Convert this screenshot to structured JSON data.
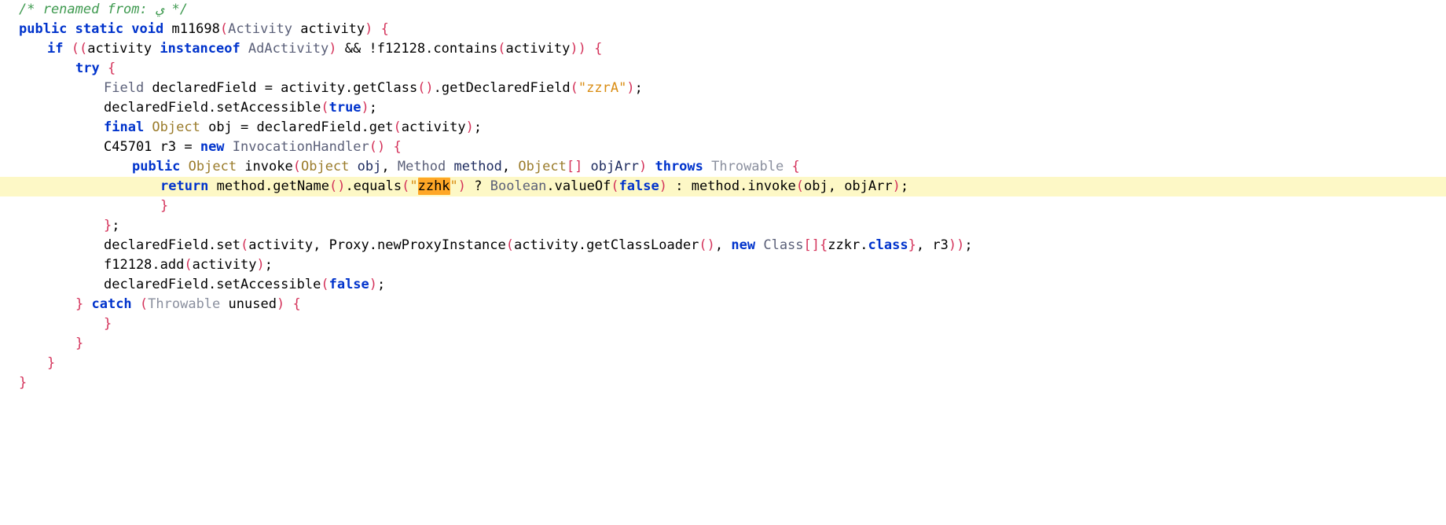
{
  "editor": {
    "title": "decompiled-java-source",
    "language": "java",
    "background_color": "#ffffff",
    "highlight_line_color": "#fdf8c6",
    "search_match_color": "#ffa726",
    "search_match_text": "zzhk",
    "colors": {
      "comment": "#3f9a50",
      "keyword": "#0033cc",
      "type": "#9a7b2a",
      "type_alt": "#5a5f78",
      "punctuation": "#d4325a",
      "string": "#d98c12",
      "variable": "#1c2a5e",
      "plain": "#000000",
      "throws_clause": "#8a8f9e"
    }
  },
  "code": {
    "lines": [
      {
        "id": "line-1",
        "indent": 0,
        "highlighted": false,
        "tokens": [
          {
            "cls": "t-comment",
            "text": "/* renamed from: ي */"
          }
        ]
      },
      {
        "id": "line-2",
        "indent": 0,
        "highlighted": false,
        "tokens": [
          {
            "cls": "t-keyword",
            "text": "public static void "
          },
          {
            "cls": "t-ident",
            "text": "m11698"
          },
          {
            "cls": "t-punct",
            "text": "("
          },
          {
            "cls": "t-type2",
            "text": "Activity"
          },
          {
            "cls": "t-plain",
            "text": " activity"
          },
          {
            "cls": "t-punct",
            "text": ")"
          },
          {
            "cls": "t-plain",
            "text": " "
          },
          {
            "cls": "t-punct",
            "text": "{"
          }
        ]
      },
      {
        "id": "line-3",
        "indent": 1,
        "highlighted": false,
        "tokens": [
          {
            "cls": "t-keyword",
            "text": "if "
          },
          {
            "cls": "t-punct",
            "text": "(("
          },
          {
            "cls": "t-plain",
            "text": "activity "
          },
          {
            "cls": "t-keyword",
            "text": "instanceof "
          },
          {
            "cls": "t-type2",
            "text": "AdActivity"
          },
          {
            "cls": "t-punct",
            "text": ")"
          },
          {
            "cls": "t-plain",
            "text": " && !f12128.contains"
          },
          {
            "cls": "t-punct",
            "text": "("
          },
          {
            "cls": "t-plain",
            "text": "activity"
          },
          {
            "cls": "t-punct",
            "text": "))"
          },
          {
            "cls": "t-plain",
            "text": " "
          },
          {
            "cls": "t-punct",
            "text": "{"
          }
        ]
      },
      {
        "id": "line-4",
        "indent": 2,
        "highlighted": false,
        "tokens": [
          {
            "cls": "t-keyword",
            "text": "try "
          },
          {
            "cls": "t-punct",
            "text": "{"
          }
        ]
      },
      {
        "id": "line-5",
        "indent": 3,
        "highlighted": false,
        "tokens": [
          {
            "cls": "t-type2",
            "text": "Field"
          },
          {
            "cls": "t-plain",
            "text": " declaredField = activity.getClass"
          },
          {
            "cls": "t-punct",
            "text": "()"
          },
          {
            "cls": "t-plain",
            "text": ".getDeclaredField"
          },
          {
            "cls": "t-punct",
            "text": "("
          },
          {
            "cls": "t-string",
            "text": "\"zzrA\""
          },
          {
            "cls": "t-punct",
            "text": ")"
          },
          {
            "cls": "t-plain",
            "text": ";"
          }
        ]
      },
      {
        "id": "line-6",
        "indent": 3,
        "highlighted": false,
        "tokens": [
          {
            "cls": "t-plain",
            "text": "declaredField.setAccessible"
          },
          {
            "cls": "t-punct",
            "text": "("
          },
          {
            "cls": "t-keyword",
            "text": "true"
          },
          {
            "cls": "t-punct",
            "text": ")"
          },
          {
            "cls": "t-plain",
            "text": ";"
          }
        ]
      },
      {
        "id": "line-7",
        "indent": 3,
        "highlighted": false,
        "tokens": [
          {
            "cls": "t-keyword",
            "text": "final "
          },
          {
            "cls": "t-type",
            "text": "Object"
          },
          {
            "cls": "t-plain",
            "text": " obj = declaredField.get"
          },
          {
            "cls": "t-punct",
            "text": "("
          },
          {
            "cls": "t-plain",
            "text": "activity"
          },
          {
            "cls": "t-punct",
            "text": ")"
          },
          {
            "cls": "t-plain",
            "text": ";"
          }
        ]
      },
      {
        "id": "line-8",
        "indent": 3,
        "highlighted": false,
        "tokens": [
          {
            "cls": "t-plain",
            "text": "C45701 r3 = "
          },
          {
            "cls": "t-keyword",
            "text": "new "
          },
          {
            "cls": "t-type2",
            "text": "InvocationHandler"
          },
          {
            "cls": "t-punct",
            "text": "()"
          },
          {
            "cls": "t-plain",
            "text": " "
          },
          {
            "cls": "t-punct",
            "text": "{"
          }
        ]
      },
      {
        "id": "line-9",
        "indent": 4,
        "highlighted": false,
        "tokens": [
          {
            "cls": "t-keyword",
            "text": "public "
          },
          {
            "cls": "t-type",
            "text": "Object"
          },
          {
            "cls": "t-plain",
            "text": " invoke"
          },
          {
            "cls": "t-punct",
            "text": "("
          },
          {
            "cls": "t-type",
            "text": "Object"
          },
          {
            "cls": "t-var",
            "text": " obj"
          },
          {
            "cls": "t-plain",
            "text": ", "
          },
          {
            "cls": "t-type2",
            "text": "Method"
          },
          {
            "cls": "t-var",
            "text": " method"
          },
          {
            "cls": "t-plain",
            "text": ", "
          },
          {
            "cls": "t-type",
            "text": "Object"
          },
          {
            "cls": "t-punct",
            "text": "[]"
          },
          {
            "cls": "t-var",
            "text": " objArr"
          },
          {
            "cls": "t-punct",
            "text": ")"
          },
          {
            "cls": "t-plain",
            "text": " "
          },
          {
            "cls": "t-keyword",
            "text": "throws "
          },
          {
            "cls": "t-throws",
            "text": "Throwable"
          },
          {
            "cls": "t-plain",
            "text": " "
          },
          {
            "cls": "t-punct",
            "text": "{"
          }
        ]
      },
      {
        "id": "line-10",
        "indent": 5,
        "highlighted": true,
        "tokens": [
          {
            "cls": "t-keyword",
            "text": "return "
          },
          {
            "cls": "t-plain",
            "text": "method.getName"
          },
          {
            "cls": "t-punct",
            "text": "()"
          },
          {
            "cls": "t-plain",
            "text": ".equals"
          },
          {
            "cls": "t-punct",
            "text": "("
          },
          {
            "cls": "t-string",
            "text": "\""
          },
          {
            "cls": "t-string match-box",
            "text": "zzhk"
          },
          {
            "cls": "t-string",
            "text": "\""
          },
          {
            "cls": "t-punct",
            "text": ")"
          },
          {
            "cls": "t-plain",
            "text": " ? "
          },
          {
            "cls": "t-type2",
            "text": "Boolean"
          },
          {
            "cls": "t-plain",
            "text": ".valueOf"
          },
          {
            "cls": "t-punct",
            "text": "("
          },
          {
            "cls": "t-keyword",
            "text": "false"
          },
          {
            "cls": "t-punct",
            "text": ")"
          },
          {
            "cls": "t-plain",
            "text": " : method.invoke"
          },
          {
            "cls": "t-punct",
            "text": "("
          },
          {
            "cls": "t-plain",
            "text": "obj, objArr"
          },
          {
            "cls": "t-punct",
            "text": ")"
          },
          {
            "cls": "t-plain",
            "text": ";"
          }
        ]
      },
      {
        "id": "line-11",
        "indent": 5,
        "highlighted": false,
        "tokens": [
          {
            "cls": "t-punct",
            "text": "}"
          }
        ]
      },
      {
        "id": "line-12",
        "indent": 3,
        "highlighted": false,
        "tokens": [
          {
            "cls": "t-punct",
            "text": "}"
          },
          {
            "cls": "t-plain",
            "text": ";"
          }
        ]
      },
      {
        "id": "line-13",
        "indent": 3,
        "highlighted": false,
        "tokens": [
          {
            "cls": "t-plain",
            "text": "declaredField.set"
          },
          {
            "cls": "t-punct",
            "text": "("
          },
          {
            "cls": "t-plain",
            "text": "activity, Proxy.newProxyInstance"
          },
          {
            "cls": "t-punct",
            "text": "("
          },
          {
            "cls": "t-plain",
            "text": "activity.getClassLoader"
          },
          {
            "cls": "t-punct",
            "text": "()"
          },
          {
            "cls": "t-plain",
            "text": ", "
          },
          {
            "cls": "t-keyword",
            "text": "new "
          },
          {
            "cls": "t-type2",
            "text": "Class"
          },
          {
            "cls": "t-punct",
            "text": "[]{"
          },
          {
            "cls": "t-plain",
            "text": "zzkr."
          },
          {
            "cls": "t-keyword",
            "text": "class"
          },
          {
            "cls": "t-punct",
            "text": "}"
          },
          {
            "cls": "t-plain",
            "text": ", r3"
          },
          {
            "cls": "t-punct",
            "text": "))"
          },
          {
            "cls": "t-plain",
            "text": ";"
          }
        ]
      },
      {
        "id": "line-14",
        "indent": 3,
        "highlighted": false,
        "tokens": [
          {
            "cls": "t-plain",
            "text": "f12128.add"
          },
          {
            "cls": "t-punct",
            "text": "("
          },
          {
            "cls": "t-plain",
            "text": "activity"
          },
          {
            "cls": "t-punct",
            "text": ")"
          },
          {
            "cls": "t-plain",
            "text": ";"
          }
        ]
      },
      {
        "id": "line-15",
        "indent": 3,
        "highlighted": false,
        "tokens": [
          {
            "cls": "t-plain",
            "text": "declaredField.setAccessible"
          },
          {
            "cls": "t-punct",
            "text": "("
          },
          {
            "cls": "t-keyword",
            "text": "false"
          },
          {
            "cls": "t-punct",
            "text": ")"
          },
          {
            "cls": "t-plain",
            "text": ";"
          }
        ]
      },
      {
        "id": "line-16",
        "indent": 2,
        "highlighted": false,
        "tokens": [
          {
            "cls": "t-punct",
            "text": "} "
          },
          {
            "cls": "t-keyword",
            "text": "catch "
          },
          {
            "cls": "t-punct",
            "text": "("
          },
          {
            "cls": "t-throws",
            "text": "Throwable"
          },
          {
            "cls": "t-plain",
            "text": " unused"
          },
          {
            "cls": "t-punct",
            "text": ")"
          },
          {
            "cls": "t-plain",
            "text": " "
          },
          {
            "cls": "t-punct",
            "text": "{"
          }
        ]
      },
      {
        "id": "line-17",
        "indent": 3,
        "highlighted": false,
        "tokens": [
          {
            "cls": "t-punct",
            "text": "}"
          }
        ]
      },
      {
        "id": "line-18",
        "indent": 2,
        "highlighted": false,
        "tokens": [
          {
            "cls": "t-punct",
            "text": "}"
          }
        ]
      },
      {
        "id": "line-19",
        "indent": 1,
        "highlighted": false,
        "tokens": [
          {
            "cls": "t-punct",
            "text": "}"
          }
        ]
      },
      {
        "id": "line-20",
        "indent": 0,
        "highlighted": false,
        "tokens": [
          {
            "cls": "t-punct",
            "text": "}"
          }
        ]
      }
    ]
  }
}
